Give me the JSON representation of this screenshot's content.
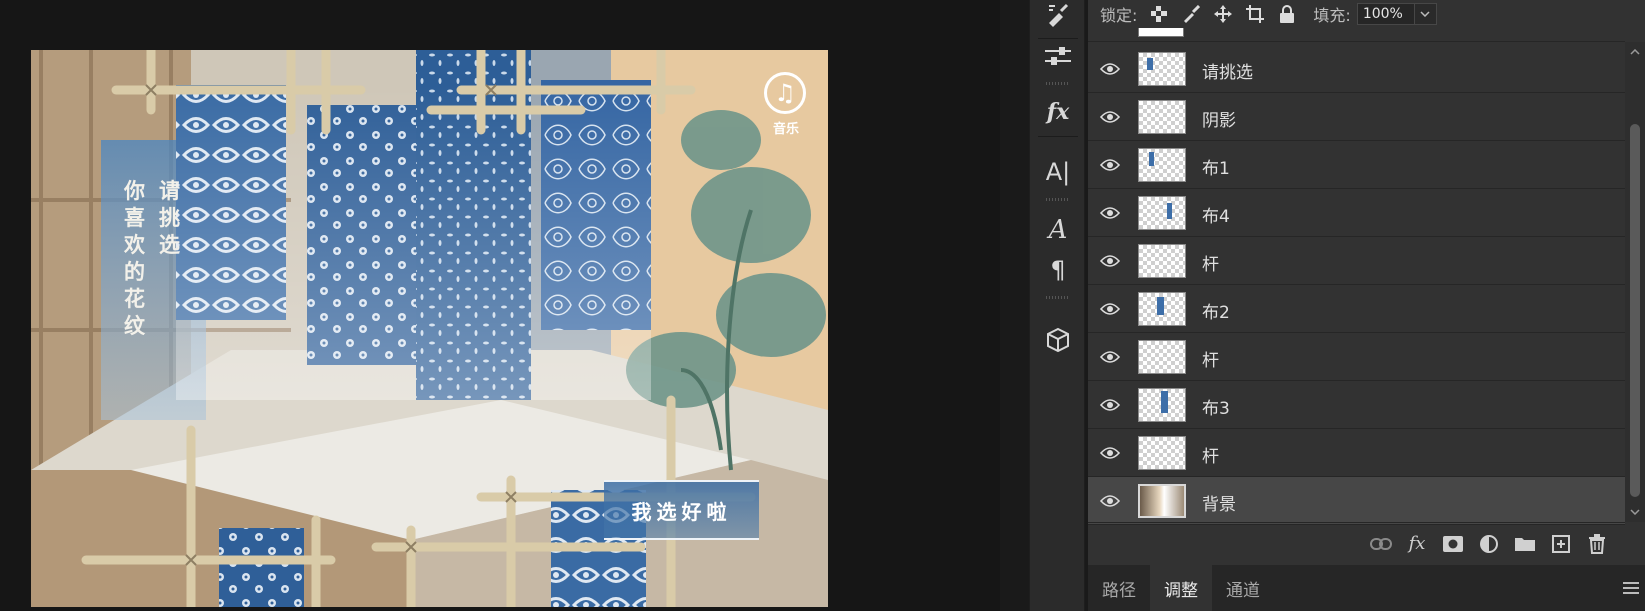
{
  "canvas": {
    "vertical_text_right": "请挑选",
    "vertical_text_left": "你喜欢的花纹",
    "music_label": "音乐",
    "confirm_label": "我选好啦"
  },
  "toolbar": {
    "items": [
      "brush-settings-icon",
      "properties-sliders-icon",
      "layer-styles-fx-icon",
      "character-icon",
      "glyphs-icon",
      "paragraph-icon",
      "3d-icon"
    ]
  },
  "layers_panel": {
    "lock_label": "锁定:",
    "fill_label": "填充:",
    "fill_value": "100%",
    "layers": [
      {
        "name": "请挑选",
        "visible": true,
        "selected": false
      },
      {
        "name": "阴影",
        "visible": true,
        "selected": false
      },
      {
        "name": "布1",
        "visible": true,
        "selected": false
      },
      {
        "name": "布4",
        "visible": true,
        "selected": false
      },
      {
        "name": "杆",
        "visible": true,
        "selected": false
      },
      {
        "name": "布2",
        "visible": true,
        "selected": false
      },
      {
        "name": "杆",
        "visible": true,
        "selected": false
      },
      {
        "name": "布3",
        "visible": true,
        "selected": false
      },
      {
        "name": "杆",
        "visible": true,
        "selected": false
      },
      {
        "name": "背景",
        "visible": true,
        "selected": true
      }
    ],
    "footer_icons": [
      "link-icon",
      "fx-icon",
      "mask-icon",
      "adjustment-icon",
      "group-folder-icon",
      "new-layer-icon",
      "trash-icon"
    ]
  },
  "bottom_tabs": {
    "tabs": [
      "路径",
      "调整",
      "通道"
    ],
    "active": "调整"
  },
  "colors": {
    "panel_bg": "#323232",
    "selected_row": "#474747",
    "fabric_blue": "#2f5f98"
  }
}
